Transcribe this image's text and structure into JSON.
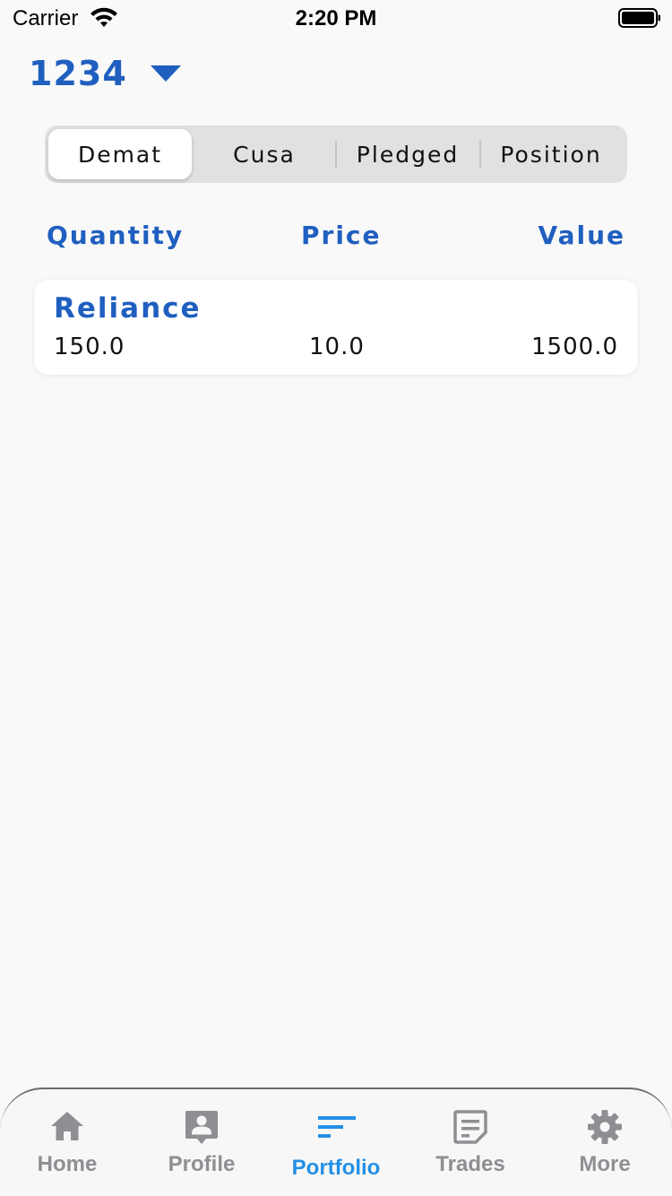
{
  "status_bar": {
    "carrier": "Carrier",
    "time": "2:20 PM"
  },
  "account": {
    "number": "1234",
    "dropdown_icon": "caret-down-icon"
  },
  "segments": {
    "selected": "Demat",
    "items": [
      {
        "label": "Demat"
      },
      {
        "label": "Cusa"
      },
      {
        "label": "Pledged"
      },
      {
        "label": "Position"
      }
    ]
  },
  "columns": {
    "quantity": "Quantity",
    "price": "Price",
    "value": "Value"
  },
  "holdings": [
    {
      "name": "Reliance",
      "quantity": "150.0",
      "price": "10.0",
      "value": "1500.0"
    }
  ],
  "tabs": [
    {
      "label": "Home",
      "icon": "home-icon"
    },
    {
      "label": "Profile",
      "icon": "profile-icon"
    },
    {
      "label": "Portfolio",
      "icon": "portfolio-icon"
    },
    {
      "label": "Trades",
      "icon": "trades-icon"
    },
    {
      "label": "More",
      "icon": "gear-icon"
    }
  ],
  "active_tab": "Portfolio",
  "colors": {
    "accent_blue": "#1f5fbf",
    "tab_active": "#2490e6",
    "tab_inactive": "#8e8e93",
    "background": "#f9f9f9"
  }
}
